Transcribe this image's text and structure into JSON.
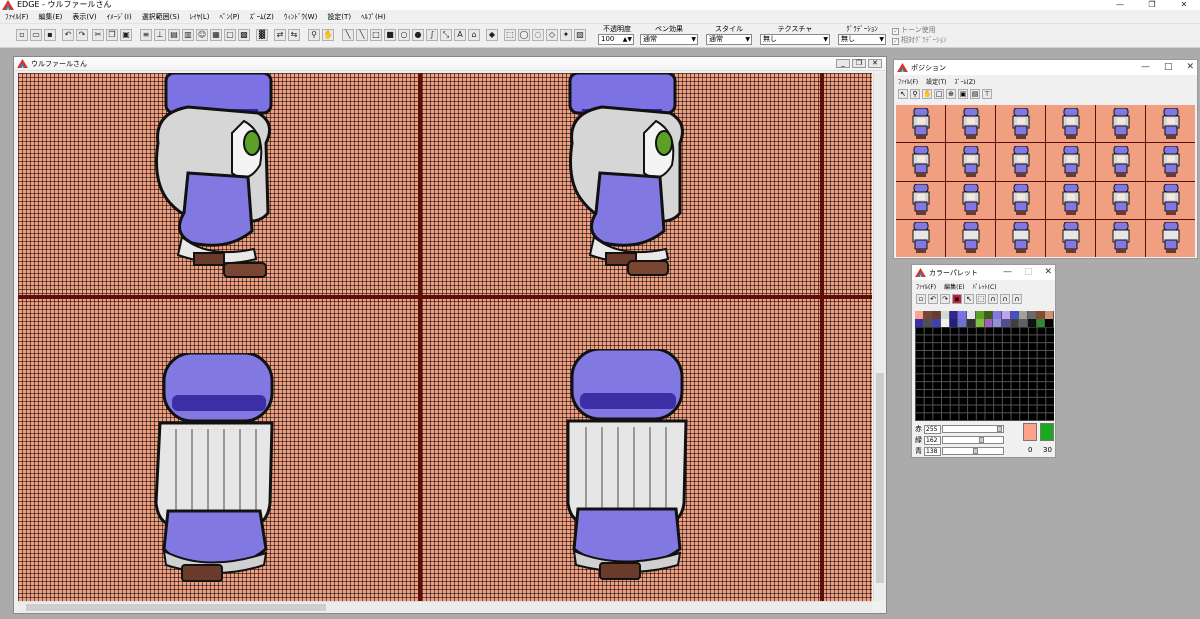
{
  "window": {
    "title": "EDGE - ウルファールさん",
    "controls": [
      "—",
      "❐",
      "✕"
    ]
  },
  "menu": [
    "ﾌｧｲﾙ(F)",
    "編集(E)",
    "表示(V)",
    "ｲﾒｰｼﾞ(I)",
    "選択範囲(S)",
    "ﾚｲﾔ(L)",
    "ﾍﾟﾝ(P)",
    "ｽﾞｰﾑ(Z)",
    "ｳｨﾝﾄﾞｳ(W)",
    "設定(T)",
    "ﾍﾙﾌﾟ(H)"
  ],
  "toolbar": {
    "opacity": {
      "label": "不透明度",
      "value": "100"
    },
    "pen_effect": {
      "label": "ペン効果",
      "value": "通常"
    },
    "style": {
      "label": "スタイル",
      "value": "通常"
    },
    "texture": {
      "label": "テクスチャ",
      "value": "無し"
    },
    "gradation": {
      "label": "ｸﾞﾗﾃﾞｰｼｮﾝ",
      "value": "無し"
    },
    "tone_use": "トーン使用",
    "relative_gradation": "相対ｸﾞﾗﾃﾞｰｼｮﾝ"
  },
  "canvas_window": {
    "title": "ウルファールさん"
  },
  "position_window": {
    "title": "ポジション",
    "menu": [
      "ﾌｧｲﾙ(F)",
      "設定(T)",
      "ｽﾞｰﾑ(Z)"
    ]
  },
  "palette_window": {
    "title": "カラーパレット",
    "menu": [
      "ﾌｧｲﾙ(F)",
      "編集(E)",
      "ﾊﾟﾚｯﾄ(C)"
    ],
    "red": {
      "label": "赤",
      "value": "255"
    },
    "green": {
      "label": "緑",
      "value": "162"
    },
    "blue": {
      "label": "青",
      "value": "138"
    },
    "index_a": "0",
    "index_b": "30",
    "colors": {
      "background": "#f0a080",
      "current": "#ffa28a",
      "secondary": "#17a91e",
      "outline": "#5a0f0a"
    }
  }
}
